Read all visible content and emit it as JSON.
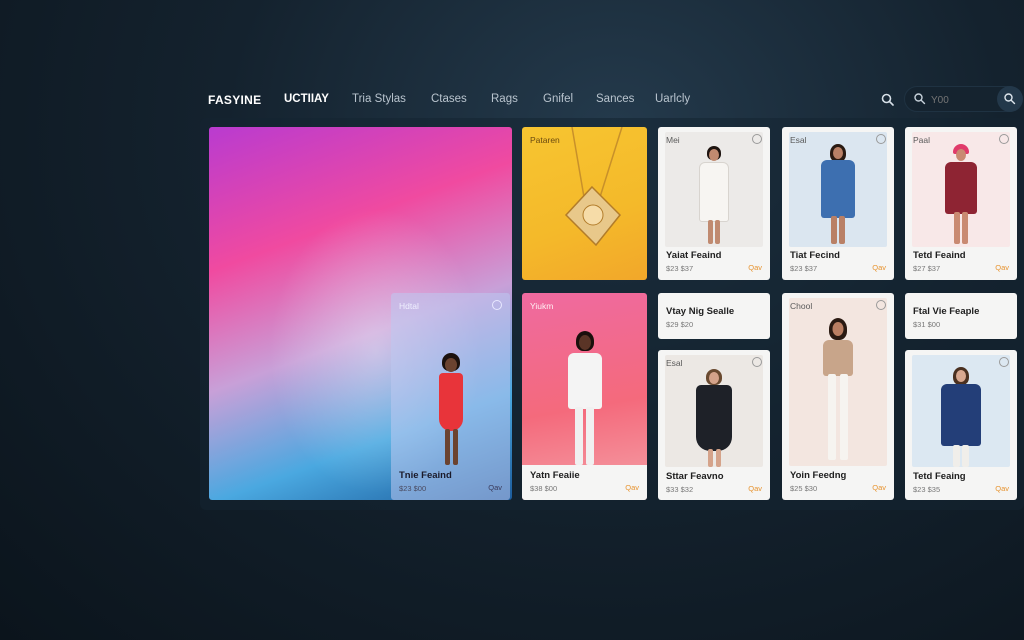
{
  "nav": {
    "brand": "FASYINE",
    "items": [
      "UCTIIAY",
      "Tria Stylas",
      "Ctases",
      "Rags",
      "Gnifel",
      "Sances",
      "Uarlcly"
    ],
    "search_placeholder": "Y00"
  },
  "hero": {
    "card_tag": "Hdtal",
    "card_title": "Tnie Feaind",
    "card_price": "$23 $00",
    "card_cta": "Qav"
  },
  "cards": {
    "necklace": {
      "tag": "Pataren"
    },
    "model_white": {
      "tag": "Yiukm",
      "title": "Yatn Feaiie",
      "price": "$38 $00",
      "cta": "Qav"
    },
    "p1": {
      "tag": "Mei",
      "title": "Yaiat Feaind",
      "price": "$23 $37",
      "cta": "Qav"
    },
    "p2": {
      "tag": "Esal",
      "title": "Tiat Fecind",
      "price": "$23 $37",
      "cta": "Qav"
    },
    "p3": {
      "tag": "Paal",
      "title": "Tetd Feaind",
      "price": "$27 $37",
      "cta": "Qav"
    },
    "banner1": {
      "title": "Vtay Nig Sealle",
      "price": "$29 $20"
    },
    "banner2": {
      "title": "Ftal Vie Feaple",
      "price": "$31 $00"
    },
    "p4": {
      "tag": "Esal",
      "title": "Sttar Feavno",
      "price": "$33 $32",
      "cta": "Qav"
    },
    "p5": {
      "tag": "Chool",
      "title": "Yoin Feedng",
      "price": "$25 $30",
      "cta": "Qav"
    },
    "p6": {
      "title": "Tetd Feaing",
      "price": "$23 $35",
      "cta": "Qav"
    }
  }
}
